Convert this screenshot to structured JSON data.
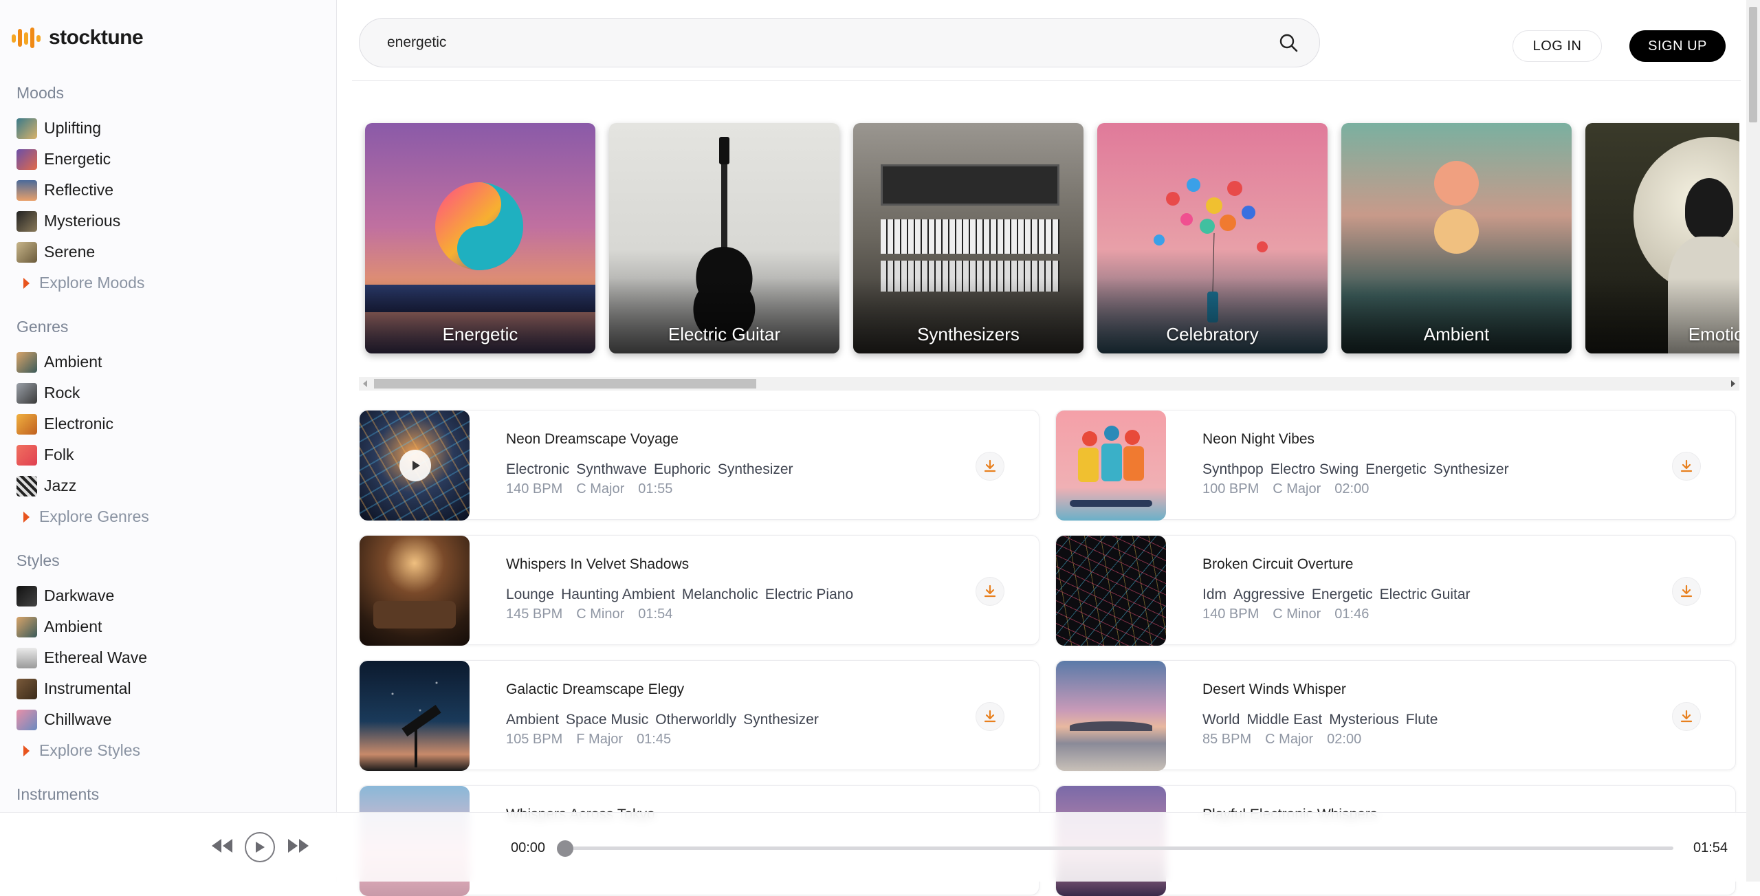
{
  "brand": {
    "name": "stocktune",
    "accent": "#f5a623"
  },
  "search": {
    "value": "energetic"
  },
  "header": {
    "login_label": "LOG IN",
    "signup_label": "SIGN UP"
  },
  "sidebar": {
    "moods": {
      "heading": "Moods",
      "items": [
        "Uplifting",
        "Energetic",
        "Reflective",
        "Mysterious",
        "Serene"
      ],
      "explore": "Explore Moods"
    },
    "genres": {
      "heading": "Genres",
      "items": [
        "Ambient",
        "Rock",
        "Electronic",
        "Folk",
        "Jazz"
      ],
      "explore": "Explore Genres"
    },
    "styles": {
      "heading": "Styles",
      "items": [
        "Darkwave",
        "Ambient",
        "Ethereal Wave",
        "Instrumental",
        "Chillwave"
      ],
      "explore": "Explore Styles"
    },
    "instruments": {
      "heading": "Instruments"
    }
  },
  "categories": [
    "Energetic",
    "Electric Guitar",
    "Synthesizers",
    "Celebratory",
    "Ambient",
    "Emotional"
  ],
  "tracks": [
    {
      "title": "Neon Dreamscape Voyage",
      "tags": [
        "Electronic",
        "Synthwave",
        "Euphoric",
        "Synthesizer"
      ],
      "bpm": "140 BPM",
      "key": "C Major",
      "duration": "01:55"
    },
    {
      "title": "Neon Night Vibes",
      "tags": [
        "Synthpop",
        "Electro Swing",
        "Energetic",
        "Synthesizer"
      ],
      "bpm": "100 BPM",
      "key": "C Major",
      "duration": "02:00"
    },
    {
      "title": "Whispers In Velvet Shadows",
      "tags": [
        "Lounge",
        "Haunting Ambient",
        "Melancholic",
        "Electric Piano"
      ],
      "bpm": "145 BPM",
      "key": "C Minor",
      "duration": "01:54"
    },
    {
      "title": "Broken Circuit Overture",
      "tags": [
        "Idm",
        "Aggressive",
        "Energetic",
        "Electric Guitar"
      ],
      "bpm": "140 BPM",
      "key": "C Minor",
      "duration": "01:46"
    },
    {
      "title": "Galactic Dreamscape Elegy",
      "tags": [
        "Ambient",
        "Space Music",
        "Otherworldly",
        "Synthesizer"
      ],
      "bpm": "105 BPM",
      "key": "F Major",
      "duration": "01:45"
    },
    {
      "title": "Desert Winds Whisper",
      "tags": [
        "World",
        "Middle East",
        "Mysterious",
        "Flute"
      ],
      "bpm": "85 BPM",
      "key": "C Major",
      "duration": "02:00"
    },
    {
      "title": "Whispers Across Tokyo",
      "tags": [],
      "bpm": "",
      "key": "",
      "duration": ""
    },
    {
      "title": "Playful Electronic Whispers",
      "tags": [],
      "bpm": "",
      "key": "",
      "duration": ""
    }
  ],
  "player": {
    "current_time": "00:00",
    "total_time": "01:54",
    "progress": 0
  },
  "icons": {
    "search": "search-icon",
    "download": "download-icon",
    "play": "play-icon",
    "rewind": "rewind-icon",
    "fast_forward": "fast-forward-icon",
    "explore_caret": "caret-right-icon"
  }
}
